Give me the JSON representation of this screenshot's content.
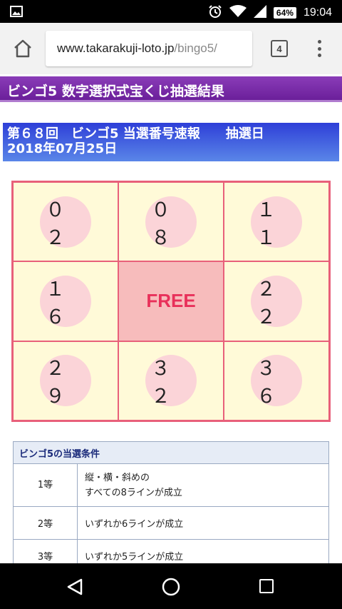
{
  "status_bar": {
    "battery": "64%",
    "time": "19:04",
    "icons": [
      "image-icon",
      "alarm-icon",
      "wifi-icon",
      "signal-icon",
      "battery-icon"
    ]
  },
  "browser": {
    "url_host": "www.takarakuji-loto.jp",
    "url_path": "/bingo5/",
    "tab_count": "4"
  },
  "page": {
    "title": "ビンゴ5 数字選択式宝くじ抽選結果",
    "header_line1": "第６８回　ビンゴ5 当選番号速報　　抽選日",
    "header_line2": "2018年07月25日"
  },
  "bingo": {
    "cells": [
      "０２",
      "０８",
      "１１",
      "１６",
      "FREE",
      "２２",
      "２９",
      "３２",
      "３６"
    ]
  },
  "conditions": {
    "header": "ビンゴ5の当選条件",
    "rows": [
      {
        "rank": "1等",
        "desc_line1": "縦・横・斜めの",
        "desc_line2": "すべての8ラインが成立"
      },
      {
        "rank": "2等",
        "desc_line1": "いずれか6ラインが成立"
      },
      {
        "rank": "3等",
        "desc_line1": "いずれか5ラインが成立"
      }
    ]
  },
  "colors": {
    "title_bg": "#7a2eaa",
    "header_bg": "#3a52dc",
    "card_border": "#e8607a",
    "cell_bg": "#fffad8",
    "free_bg": "#f7bcbc",
    "ball_bg": "#fbd4d8",
    "free_text": "#e8305a"
  }
}
